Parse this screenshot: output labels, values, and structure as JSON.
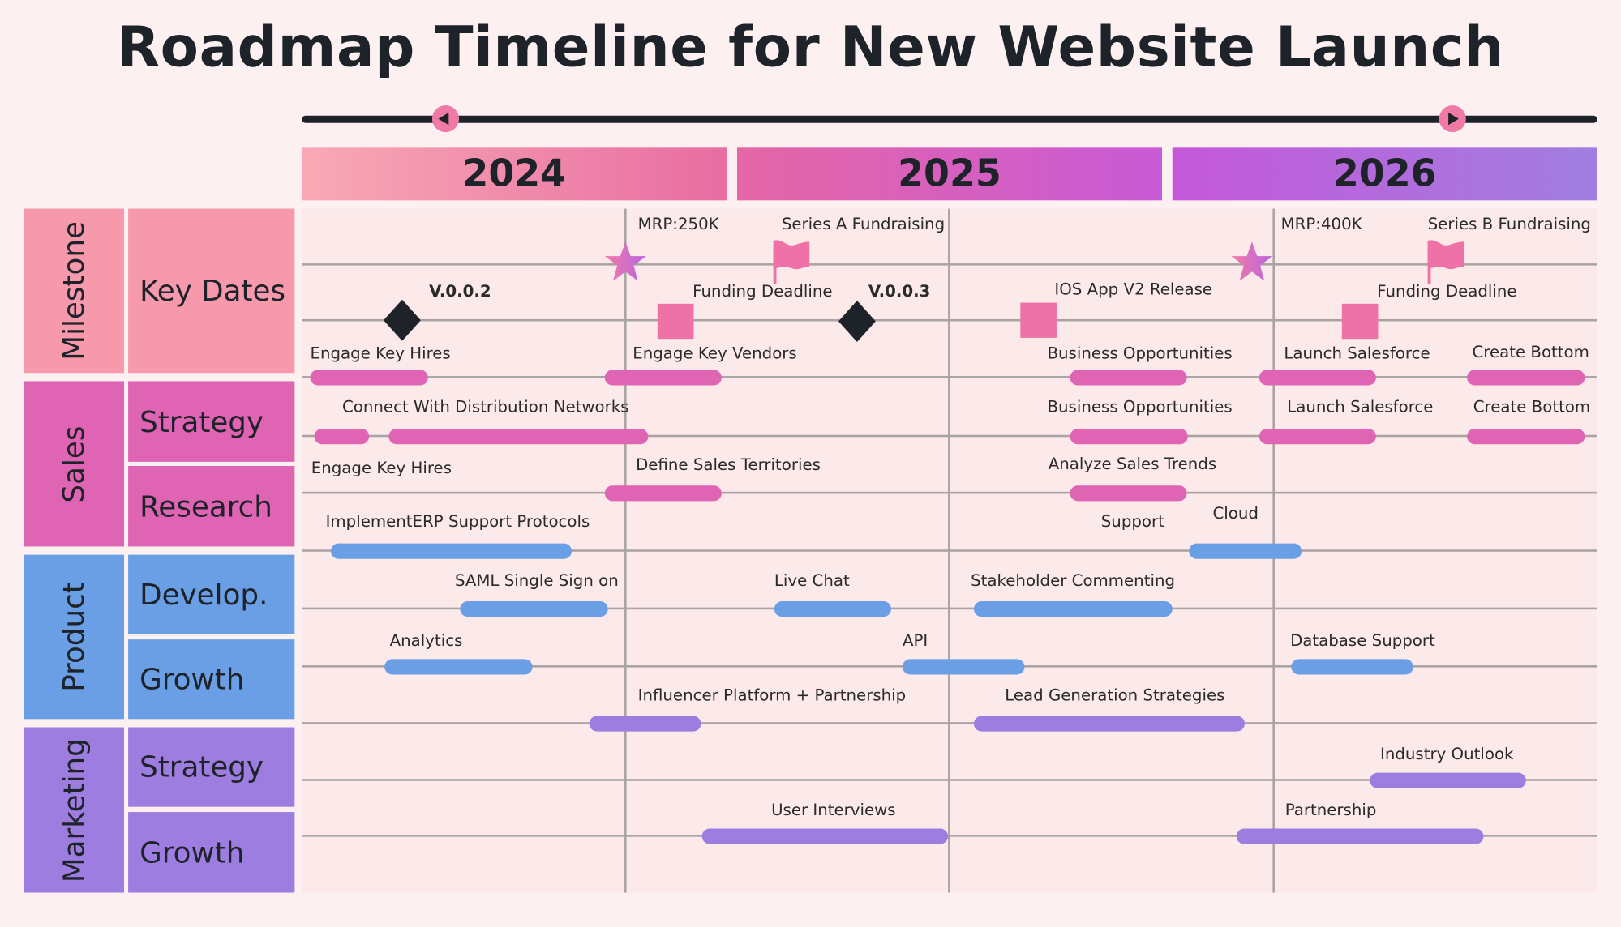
{
  "title": "Roadmap Timeline for New Website Launch",
  "colors": {
    "milestone": "#f799ad",
    "sales": "#e064b4",
    "product": "#6a9fe6",
    "marketing": "#9d7de0",
    "marker_pink": "#ef72a6",
    "diamond": "#1e2229",
    "grid_bg": "#fce9ea"
  },
  "timeline_slider": {
    "left_handle_icon": "play-left-icon",
    "right_handle_icon": "play-right-icon"
  },
  "years": [
    "2024",
    "2025",
    "2026"
  ],
  "categories": [
    {
      "label": "Milestone",
      "subcategories": [
        "Key Dates"
      ]
    },
    {
      "label": "Sales",
      "subcategories": [
        "Strategy",
        "Research"
      ]
    },
    {
      "label": "Product",
      "subcategories": [
        "Develop.",
        "Growth"
      ]
    },
    {
      "label": "Marketing",
      "subcategories": [
        "Strategy",
        "Growth"
      ]
    }
  ],
  "milestones": [
    {
      "type": "star",
      "label": "MRP:250K"
    },
    {
      "type": "flag",
      "label": "Series A Fundraising"
    },
    {
      "type": "diamond",
      "label": "V.0.0.2"
    },
    {
      "type": "square",
      "label": "Funding Deadline"
    },
    {
      "type": "diamond",
      "label": "V.0.0.3"
    },
    {
      "type": "square",
      "label": "IOS App V2 Release"
    },
    {
      "type": "star",
      "label": "MRP:400K"
    },
    {
      "type": "flag",
      "label": "Series B Fundraising"
    },
    {
      "type": "square",
      "label": "Funding Deadline"
    }
  ],
  "tasks": [
    {
      "label": "Engage Key Hires",
      "group": "sales"
    },
    {
      "label": "Engage Key Vendors",
      "group": "sales"
    },
    {
      "label": "Business Opportunities",
      "group": "sales"
    },
    {
      "label": "Launch Salesforce",
      "group": "sales"
    },
    {
      "label": "Create Bottom",
      "group": "sales"
    },
    {
      "label": "",
      "group": "sales"
    },
    {
      "label": "Connect With Distribution Networks",
      "group": "sales"
    },
    {
      "label": "Business Opportunities",
      "group": "sales"
    },
    {
      "label": "Launch Salesforce",
      "group": "sales"
    },
    {
      "label": "Create Bottom",
      "group": "sales"
    },
    {
      "label": "Engage Key Hires",
      "group": "sales"
    },
    {
      "label": "Define Sales Territories",
      "group": "sales"
    },
    {
      "label": "Analyze Sales Trends",
      "group": "sales"
    },
    {
      "label": "ImplementERP Support Protocols",
      "group": "product"
    },
    {
      "label": "Support",
      "group": "product"
    },
    {
      "label": "Cloud",
      "group": "product"
    },
    {
      "label": "SAML Single Sign on",
      "group": "product"
    },
    {
      "label": "Live Chat",
      "group": "product"
    },
    {
      "label": "Stakeholder Commenting",
      "group": "product"
    },
    {
      "label": "Analytics",
      "group": "product"
    },
    {
      "label": "API",
      "group": "product"
    },
    {
      "label": "Database Support",
      "group": "product"
    },
    {
      "label": "Influencer Platform + Partnership",
      "group": "marketing"
    },
    {
      "label": "Lead Generation Strategies",
      "group": "marketing"
    },
    {
      "label": "Industry Outlook",
      "group": "marketing"
    },
    {
      "label": "User Interviews",
      "group": "marketing"
    },
    {
      "label": "Partnership",
      "group": "marketing"
    }
  ]
}
